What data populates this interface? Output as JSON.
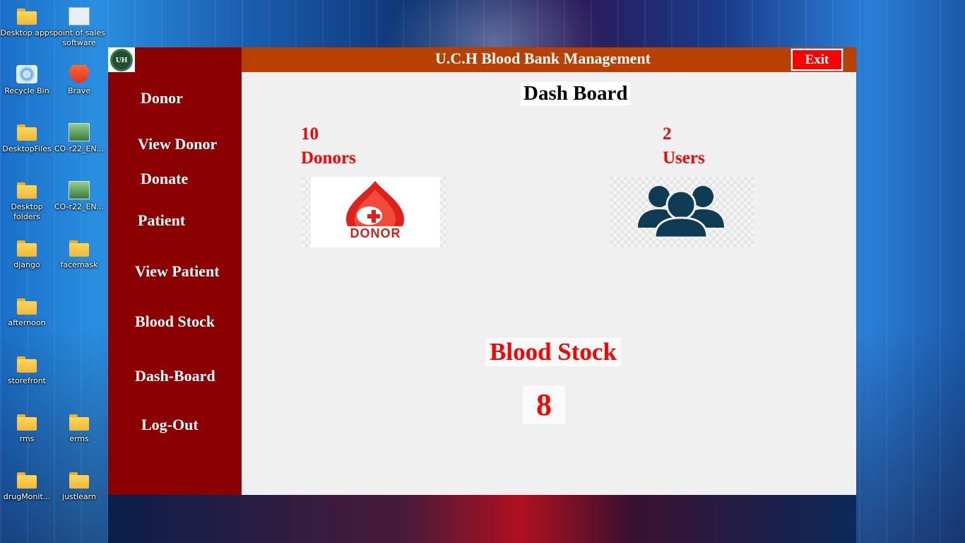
{
  "desktop": {
    "icons": [
      {
        "label": "Desktop apps",
        "icon": "folder-icon"
      },
      {
        "label": "point of sales software",
        "icon": "shortcut-icon"
      },
      {
        "label": "Recycle Bin",
        "icon": "recycle-bin-icon"
      },
      {
        "label": "Brave",
        "icon": "brave-browser-icon"
      },
      {
        "label": "DesktopFiles",
        "icon": "folder-icon"
      },
      {
        "label": "CO-r22_EN...",
        "icon": "image-file-icon"
      },
      {
        "label": "Desktop folders",
        "icon": "folder-icon"
      },
      {
        "label": "CO-r22_EN...",
        "icon": "image-file-icon"
      },
      {
        "label": "django",
        "icon": "folder-icon"
      },
      {
        "label": "facemask",
        "icon": "folder-icon"
      },
      {
        "label": "afternoon",
        "icon": "folder-icon"
      },
      {
        "label": "storefront",
        "icon": "folder-icon"
      },
      {
        "label": "rms",
        "icon": "folder-icon"
      },
      {
        "label": "erms",
        "icon": "folder-icon"
      },
      {
        "label": "drugMonit...",
        "icon": "folder-icon"
      },
      {
        "label": "justlearn",
        "icon": "folder-icon"
      }
    ]
  },
  "app": {
    "logo_text": "UH",
    "title": "U.C.H Blood Bank Management",
    "exit_label": "Exit",
    "colors": {
      "sidebar": "#8b0000",
      "header": "#b84000",
      "accent": "#ff0000"
    },
    "sidebar": {
      "items": [
        "Donor",
        "View Donor",
        "Donate",
        "Patient",
        "View Patient",
        "Blood Stock",
        "Dash-Board",
        "Log-Out"
      ]
    },
    "dashboard": {
      "heading": "Dash Board",
      "donors_count": "10",
      "donors_label": "Donors",
      "donor_logo_text": "DONOR",
      "users_count": "2",
      "users_label": "Users",
      "blood_stock_label": "Blood Stock",
      "blood_stock_value": "8"
    }
  }
}
